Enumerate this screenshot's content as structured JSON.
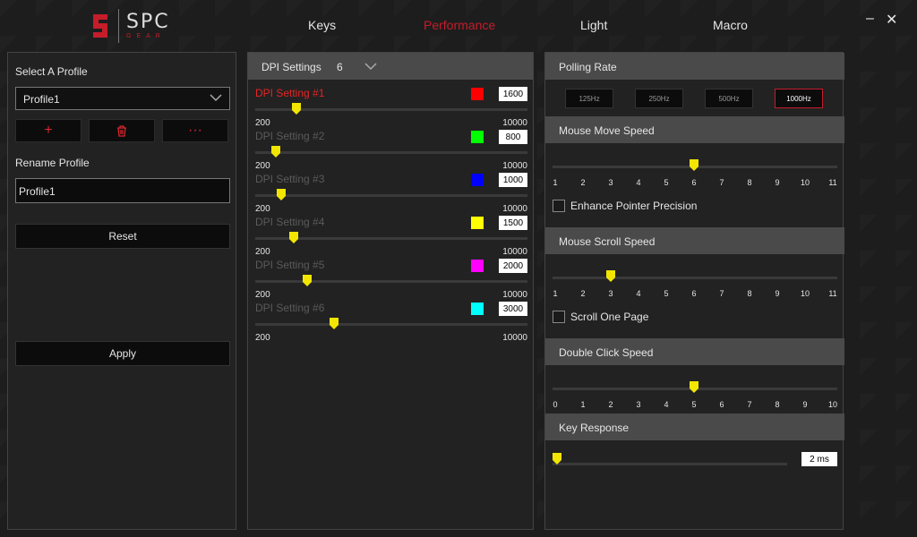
{
  "logo": {
    "brand": "SPC",
    "sub": "GEAR"
  },
  "nav": {
    "tabs": [
      {
        "label": "Keys"
      },
      {
        "label": "Performance"
      },
      {
        "label": "Light"
      },
      {
        "label": "Macro"
      }
    ],
    "active": "Performance"
  },
  "window": {
    "minimize": "–",
    "close": "✕"
  },
  "profile": {
    "select_label": "Select A Profile",
    "selected": "Profile1",
    "rename_label": "Rename Profile",
    "rename_value": "Profile1",
    "reset_label": "Reset",
    "apply_label": "Apply",
    "add_symbol": "+",
    "delete_symbol": "🗑",
    "more_symbol": "···"
  },
  "dpi": {
    "header": "DPI Settings",
    "count": "6",
    "min_label": "200",
    "max_label": "10000",
    "items": [
      {
        "name": "DPI Setting #1",
        "value": "1600",
        "color": "#ff0000",
        "level": 1600,
        "active": true
      },
      {
        "name": "DPI Setting #2",
        "value": "800",
        "color": "#00ff00",
        "level": 800,
        "active": false
      },
      {
        "name": "DPI Setting #3",
        "value": "1000",
        "color": "#0000ff",
        "level": 1000,
        "active": false
      },
      {
        "name": "DPI Setting #4",
        "value": "1500",
        "color": "#ffff00",
        "level": 1500,
        "active": false
      },
      {
        "name": "DPI Setting #5",
        "value": "2000",
        "color": "#ff00ff",
        "level": 2000,
        "active": false
      },
      {
        "name": "DPI Setting #6",
        "value": "3000",
        "color": "#00ffff",
        "level": 3000,
        "active": false
      }
    ]
  },
  "polling": {
    "header": "Polling Rate",
    "options": [
      "125Hz",
      "250Hz",
      "500Hz",
      "1000Hz"
    ],
    "selected": "1000Hz"
  },
  "move_speed": {
    "header": "Mouse Move Speed",
    "scale": [
      "1",
      "2",
      "3",
      "4",
      "5",
      "6",
      "7",
      "8",
      "9",
      "10",
      "11"
    ],
    "value": 6,
    "checkbox_label": "Enhance Pointer Precision"
  },
  "scroll_speed": {
    "header": "Mouse Scroll Speed",
    "scale": [
      "1",
      "2",
      "3",
      "4",
      "5",
      "6",
      "7",
      "8",
      "9",
      "10",
      "11"
    ],
    "value": 3,
    "checkbox_label": "Scroll One Page"
  },
  "double_click": {
    "header": "Double Click Speed",
    "scale": [
      "0",
      "1",
      "2",
      "3",
      "4",
      "5",
      "6",
      "7",
      "8",
      "9",
      "10"
    ],
    "value": 5
  },
  "key_response": {
    "header": "Key Response",
    "value_label": "2 ms",
    "value": 2
  },
  "colors": {
    "accent": "#c51d2a",
    "thumb": "#f2e600"
  }
}
